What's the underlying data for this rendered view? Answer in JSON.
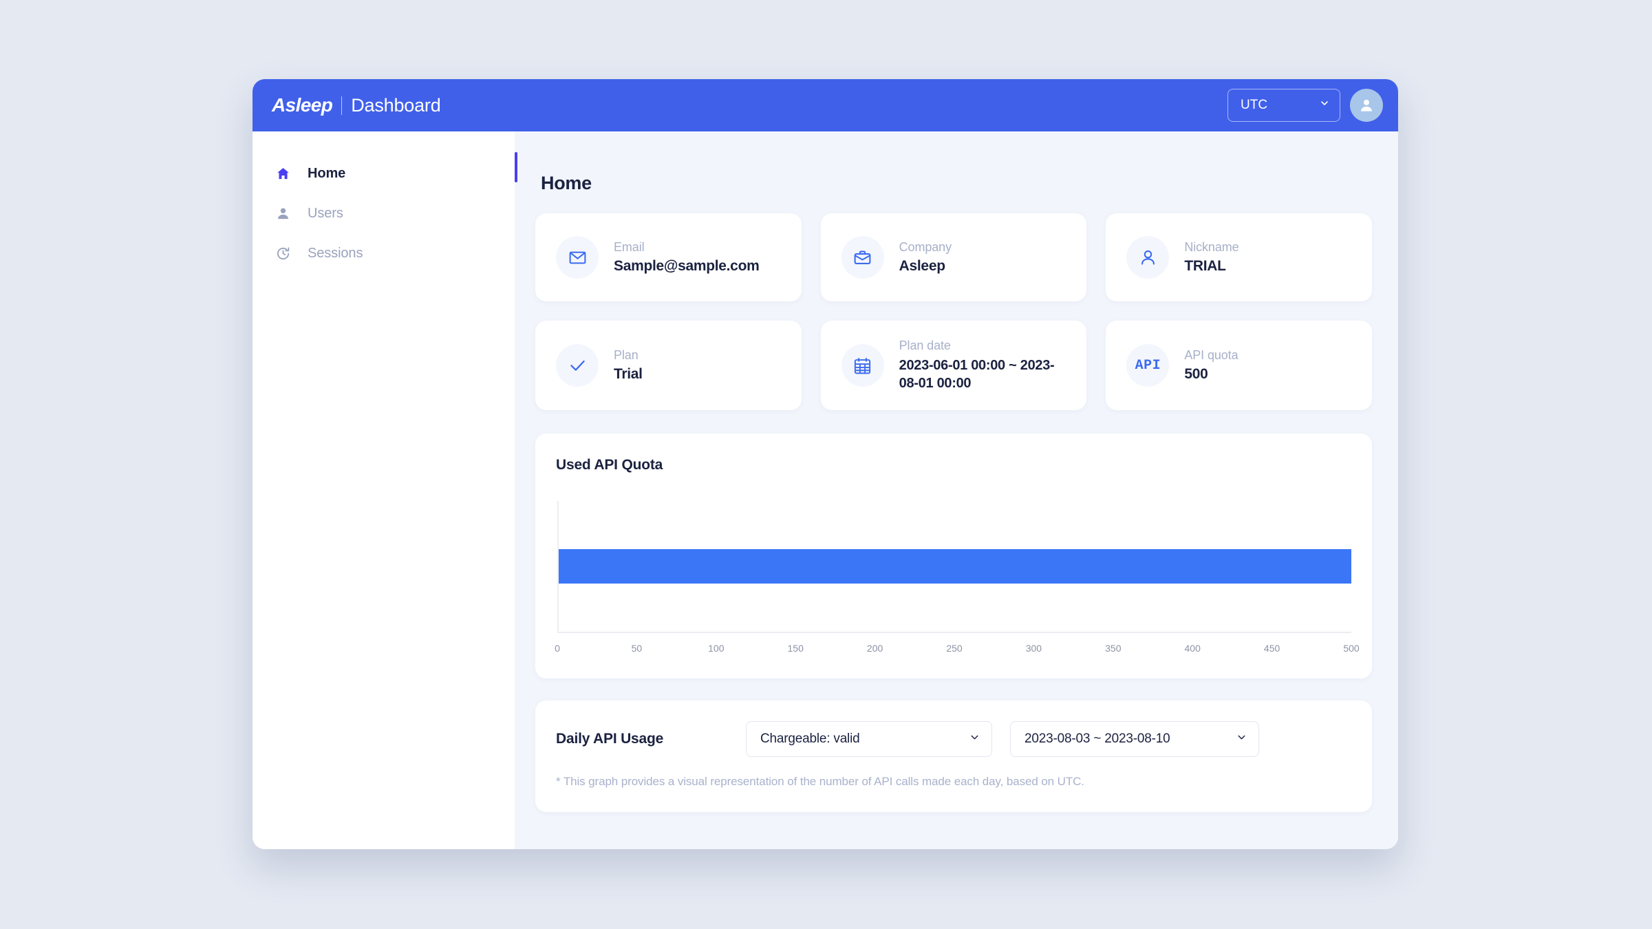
{
  "topbar": {
    "brand": "Asleep",
    "brand_sub": "Dashboard",
    "timezone": "UTC",
    "timezone_icon": "chevron-down-icon",
    "avatar_icon": "user-avatar-icon"
  },
  "sidebar": {
    "items": [
      {
        "label": "Home",
        "icon": "home-icon",
        "active": true
      },
      {
        "label": "Users",
        "icon": "user-icon",
        "active": false
      },
      {
        "label": "Sessions",
        "icon": "history-icon",
        "active": false
      }
    ]
  },
  "page": {
    "title": "Home"
  },
  "cards": [
    {
      "icon": "envelope-icon",
      "label": "Email",
      "value": "Sample@sample.com"
    },
    {
      "icon": "briefcase-icon",
      "label": "Company",
      "value": "Asleep"
    },
    {
      "icon": "person-icon",
      "label": "Nickname",
      "value": "TRIAL"
    },
    {
      "icon": "check-icon",
      "label": "Plan",
      "value": "Trial"
    },
    {
      "icon": "calendar-icon",
      "label": "Plan date",
      "value": "2023-06-01 00:00 ~ 2023-08-01 00:00"
    },
    {
      "icon": "api-icon",
      "label": "API quota",
      "value": "500"
    }
  ],
  "quota_panel": {
    "title": "Used API Quota"
  },
  "daily_panel": {
    "title": "Daily API Usage",
    "chargeable_value": "Chargeable: valid",
    "chargeable_icon": "chevron-down-icon",
    "date_range_value": "2023-08-03 ~ 2023-08-10",
    "date_range_icon": "chevron-down-icon",
    "footnote": "* This graph provides a visual representation of the number of API calls made each day, based on UTC."
  },
  "colors": {
    "brand_blue": "#4060ea",
    "bar_blue": "#3b76f6",
    "accent_indigo": "#4a3ef0",
    "page_background": "#e4e9f2",
    "content_background": "#f2f5fb"
  },
  "chart_data": {
    "type": "bar",
    "orientation": "horizontal",
    "title": "Used API Quota",
    "categories": [
      "Used API Quota"
    ],
    "values": [
      500
    ],
    "xlabel": "",
    "ylabel": "",
    "xlim": [
      0,
      500
    ],
    "xticks": [
      0,
      50,
      100,
      150,
      200,
      250,
      300,
      350,
      400,
      450,
      500
    ],
    "tick_labels": [
      "0",
      "50",
      "100",
      "150",
      "200",
      "250",
      "300",
      "350",
      "400",
      "450",
      "500"
    ],
    "grid": false,
    "legend": false,
    "bar_color": "#3b76f6"
  }
}
